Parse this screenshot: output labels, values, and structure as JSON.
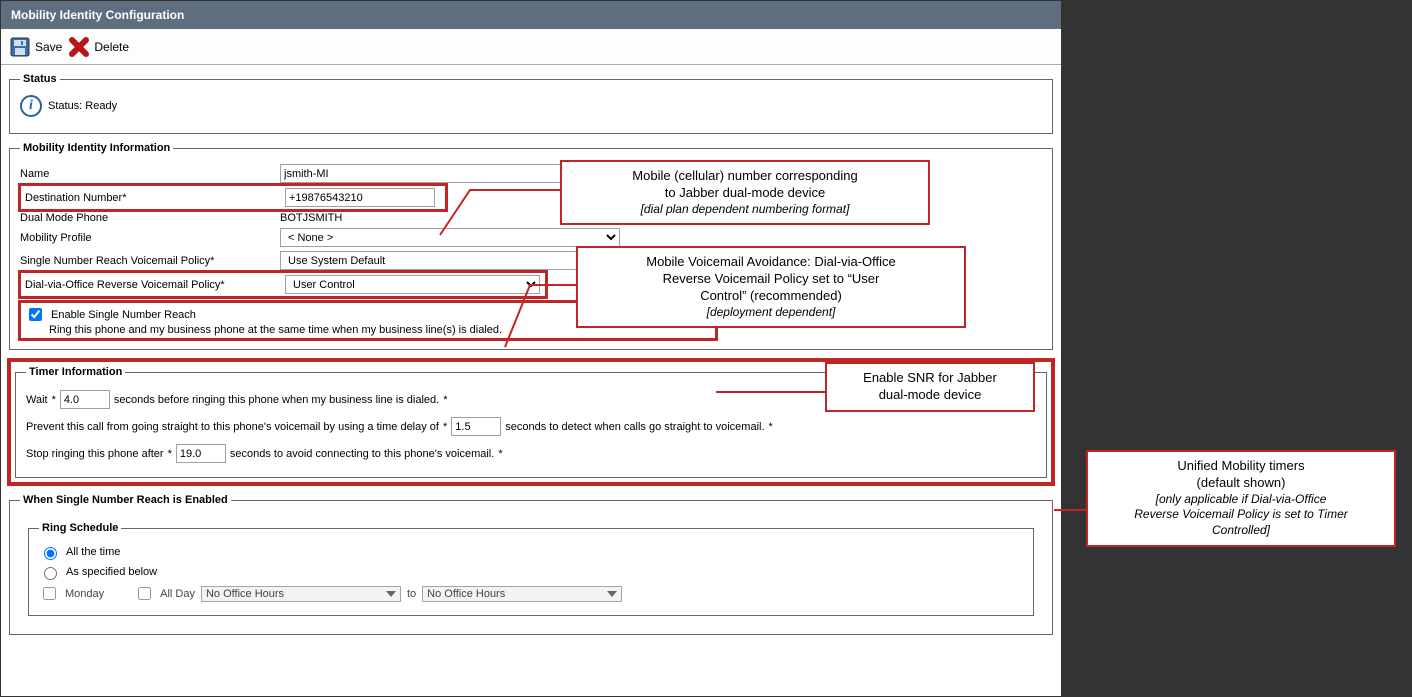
{
  "title": "Mobility Identity Configuration",
  "toolbar": {
    "save": "Save",
    "delete": "Delete"
  },
  "status": {
    "label": "Status",
    "text": "Status: Ready"
  },
  "identity": {
    "legend": "Mobility Identity Information",
    "name_label": "Name",
    "name_value": "jsmith-MI",
    "dest_label": "Destination Number",
    "dest_value": "+19876543210",
    "dual_label": "Dual Mode Phone",
    "dual_value": "BOTJSMITH",
    "profile_label": "Mobility Profile",
    "profile_value": "< None >",
    "snrvp_label": "Single Number Reach Voicemail Policy",
    "snrvp_value": "Use System Default",
    "dvorp_label": "Dial-via-Office Reverse Voicemail Policy",
    "dvorp_value": "User Control",
    "snr_enable_label": "Enable Single Number Reach",
    "snr_sub": "Ring this phone and my business phone at the same time when my business line(s) is dialed."
  },
  "timer": {
    "legend": "Timer Information",
    "wait_pre": "Wait",
    "wait_val": "4.0",
    "wait_post": "seconds before ringing this phone when my business line is dialed.",
    "prev_pre": "Prevent this call from going straight to this phone's voicemail by using a time delay of",
    "prev_val": "1.5",
    "prev_post": "seconds to detect when calls go straight to voicemail.",
    "stop_pre": "Stop ringing this phone after",
    "stop_val": "19.0",
    "stop_post": "seconds to avoid connecting to this phone's voicemail."
  },
  "snr_section": {
    "legend": "When Single Number Reach is Enabled",
    "ring_legend": "Ring Schedule",
    "all_time": "All the time",
    "as_spec": "As specified below",
    "monday": "Monday",
    "allday": "All Day",
    "no_office": "No Office Hours",
    "to": "to"
  },
  "callouts": {
    "c1a": "Mobile (cellular) number corresponding",
    "c1b": "to Jabber dual-mode device",
    "c1c": "[dial plan dependent numbering format]",
    "c2a": "Mobile Voicemail Avoidance: Dial-via-Office",
    "c2b": "Reverse Voicemail Policy set to “User",
    "c2c": "Control” (recommended)",
    "c2d": "[deployment dependent]",
    "c3a": "Enable SNR for Jabber",
    "c3b": "dual-mode device",
    "c4a": "Unified Mobility timers",
    "c4b": "(default shown)",
    "c4c": "[only applicable if Dial-via-Office",
    "c4d": "Reverse Voicemail Policy is set to Timer",
    "c4e": "Controlled]"
  }
}
